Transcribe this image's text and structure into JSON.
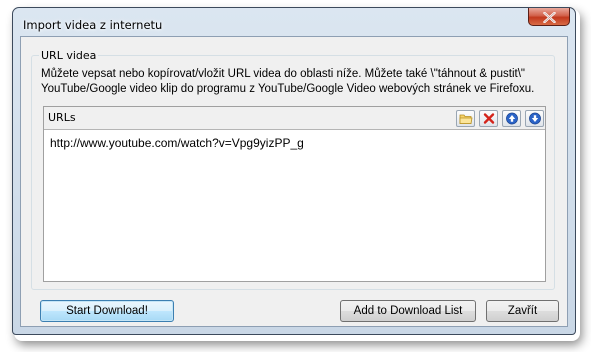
{
  "window": {
    "title": "Import videa z internetu"
  },
  "group": {
    "title": "URL videa",
    "description": "Můžete vepsat nebo kopírovat/vložit URL videa do oblasti níže. Můžete také \\\"táhnout & pustit\\\" YouTube/Google video klip do programu z YouTube/Google Video webových stránek ve Firefoxu."
  },
  "urls": {
    "label": "URLs",
    "items": [
      "http://www.youtube.com/watch?v=Vpg9yizPP_g"
    ],
    "toolbar_icons": [
      "folder-icon",
      "delete-icon",
      "move-up-icon",
      "move-down-icon"
    ]
  },
  "buttons": {
    "start": "Start Download!",
    "add": "Add to Download List",
    "close": "Zavřít"
  },
  "colors": {
    "close_button": "#c2391e",
    "default_button_border": "#3c7fb1",
    "move_arrow": "#2a63c7",
    "delete_x": "#d4241b"
  }
}
